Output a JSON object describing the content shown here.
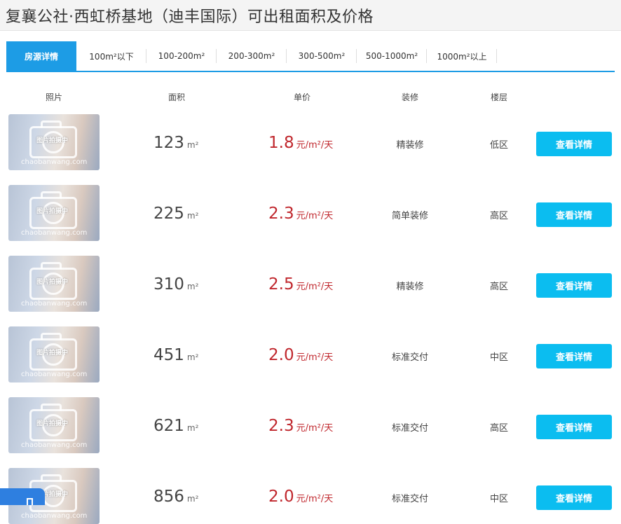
{
  "page_title": "复襄公社·西虹桥基地（迪丰国际）可出租面积及价格",
  "tabs": [
    {
      "label": "房源详情",
      "active": true
    },
    {
      "label": "100m²以下",
      "active": false
    },
    {
      "label": "100-200m²",
      "active": false
    },
    {
      "label": "200-300m²",
      "active": false
    },
    {
      "label": "300-500m²",
      "active": false
    },
    {
      "label": "500-1000m²",
      "active": false
    },
    {
      "label": "1000m²以上",
      "active": false
    }
  ],
  "columns": {
    "photo": "照片",
    "area": "面积",
    "price": "单价",
    "decoration": "装修",
    "floor": "楼层"
  },
  "watermark": {
    "text": "图片拍摄中",
    "url": "chaobanwang.com"
  },
  "units": {
    "area": "m²",
    "price": "元/m²/天"
  },
  "button_label": "查看详情",
  "listings": [
    {
      "area": "123",
      "price": "1.8",
      "decoration": "精装修",
      "floor": "低区"
    },
    {
      "area": "225",
      "price": "2.3",
      "decoration": "简单装修",
      "floor": "高区"
    },
    {
      "area": "310",
      "price": "2.5",
      "decoration": "精装修",
      "floor": "高区"
    },
    {
      "area": "451",
      "price": "2.0",
      "decoration": "标准交付",
      "floor": "中区"
    },
    {
      "area": "621",
      "price": "2.3",
      "decoration": "标准交付",
      "floor": "高区"
    },
    {
      "area": "856",
      "price": "2.0",
      "decoration": "标准交付",
      "floor": "中区"
    }
  ],
  "colors": {
    "accent": "#1d9ce5",
    "price": "#c0272d",
    "button": "#0bbdf0"
  }
}
